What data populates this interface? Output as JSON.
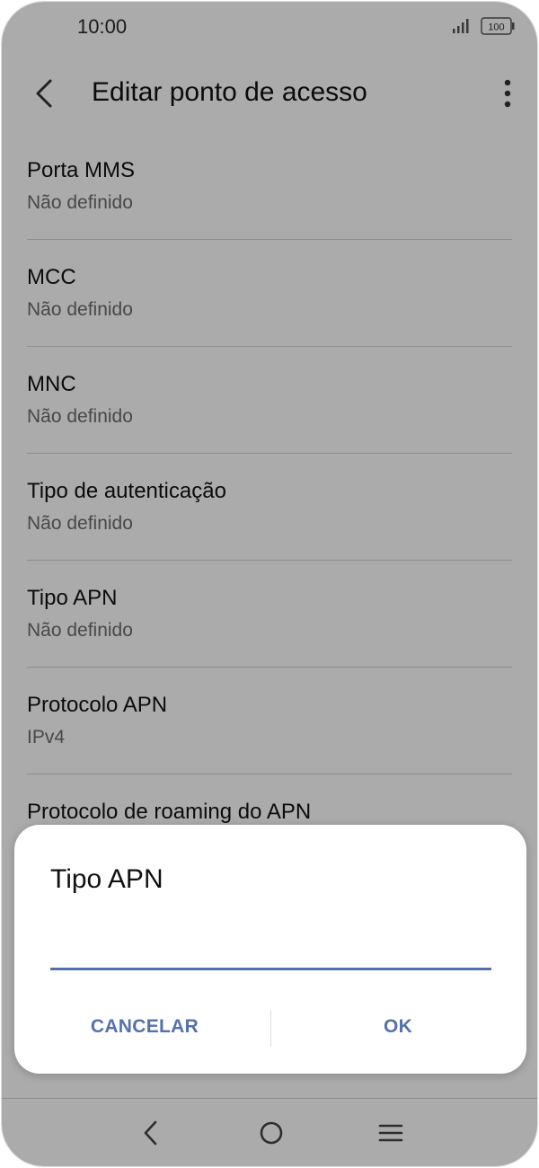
{
  "status_bar": {
    "time": "10:00",
    "battery": "100",
    "icons": [
      "signal-icon",
      "battery-icon"
    ]
  },
  "app_bar": {
    "title": "Editar ponto de acesso",
    "icons": [
      "back-icon",
      "more-options-icon"
    ]
  },
  "settings": [
    {
      "label": "Porta MMS",
      "value": "Não definido"
    },
    {
      "label": "MCC",
      "value": "Não definido"
    },
    {
      "label": "MNC",
      "value": "Não definido"
    },
    {
      "label": "Tipo de autenticação",
      "value": "Não definido"
    },
    {
      "label": "Tipo APN",
      "value": "Não definido"
    },
    {
      "label": "Protocolo APN",
      "value": "IPv4"
    },
    {
      "label": "Protocolo de roaming do APN",
      "value": ""
    }
  ],
  "dialog": {
    "title": "Tipo APN",
    "input_value": "",
    "cancel_label": "CANCELAR",
    "ok_label": "OK"
  },
  "nav_bar": {
    "icons": [
      "nav-back-icon",
      "home-icon",
      "recent-apps-icon"
    ]
  },
  "colors": {
    "accent": "#5471ae",
    "scrim": "#000000"
  }
}
